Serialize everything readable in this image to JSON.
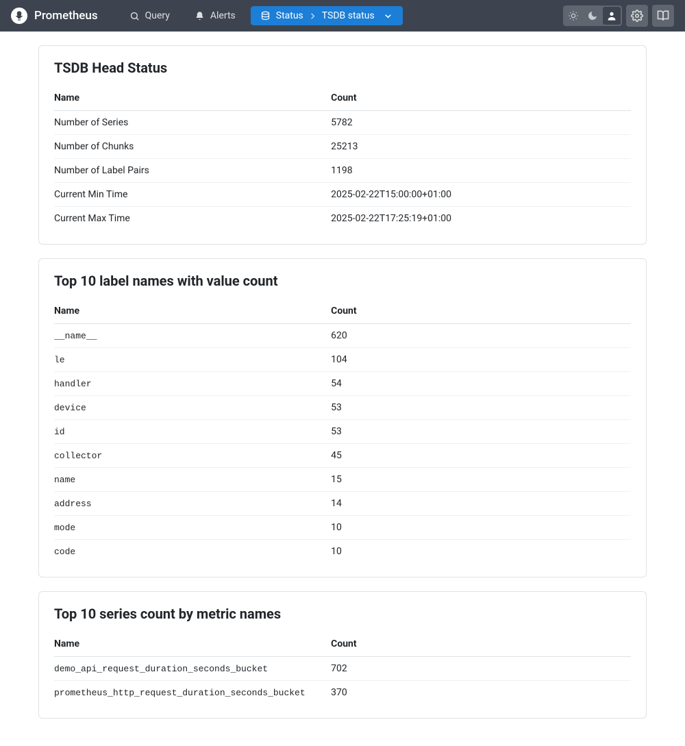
{
  "brand": {
    "name": "Prometheus"
  },
  "nav": {
    "query": "Query",
    "alerts": "Alerts",
    "status": "Status",
    "breadcrumb": "TSDB status"
  },
  "headStatus": {
    "title": "TSDB Head Status",
    "headers": {
      "name": "Name",
      "count": "Count"
    },
    "rows": [
      {
        "name": "Number of Series",
        "value": "5782"
      },
      {
        "name": "Number of Chunks",
        "value": "25213"
      },
      {
        "name": "Number of Label Pairs",
        "value": "1198"
      },
      {
        "name": "Current Min Time",
        "value": "2025-02-22T15:00:00+01:00"
      },
      {
        "name": "Current Max Time",
        "value": "2025-02-22T17:25:19+01:00"
      }
    ]
  },
  "labelNames": {
    "title": "Top 10 label names with value count",
    "headers": {
      "name": "Name",
      "count": "Count"
    },
    "rows": [
      {
        "name": "__name__",
        "value": "620"
      },
      {
        "name": "le",
        "value": "104"
      },
      {
        "name": "handler",
        "value": "54"
      },
      {
        "name": "device",
        "value": "53"
      },
      {
        "name": "id",
        "value": "53"
      },
      {
        "name": "collector",
        "value": "45"
      },
      {
        "name": "name",
        "value": "15"
      },
      {
        "name": "address",
        "value": "14"
      },
      {
        "name": "mode",
        "value": "10"
      },
      {
        "name": "code",
        "value": "10"
      }
    ]
  },
  "seriesCount": {
    "title": "Top 10 series count by metric names",
    "headers": {
      "name": "Name",
      "count": "Count"
    },
    "rows": [
      {
        "name": "demo_api_request_duration_seconds_bucket",
        "value": "702"
      },
      {
        "name": "prometheus_http_request_duration_seconds_bucket",
        "value": "370"
      }
    ]
  }
}
